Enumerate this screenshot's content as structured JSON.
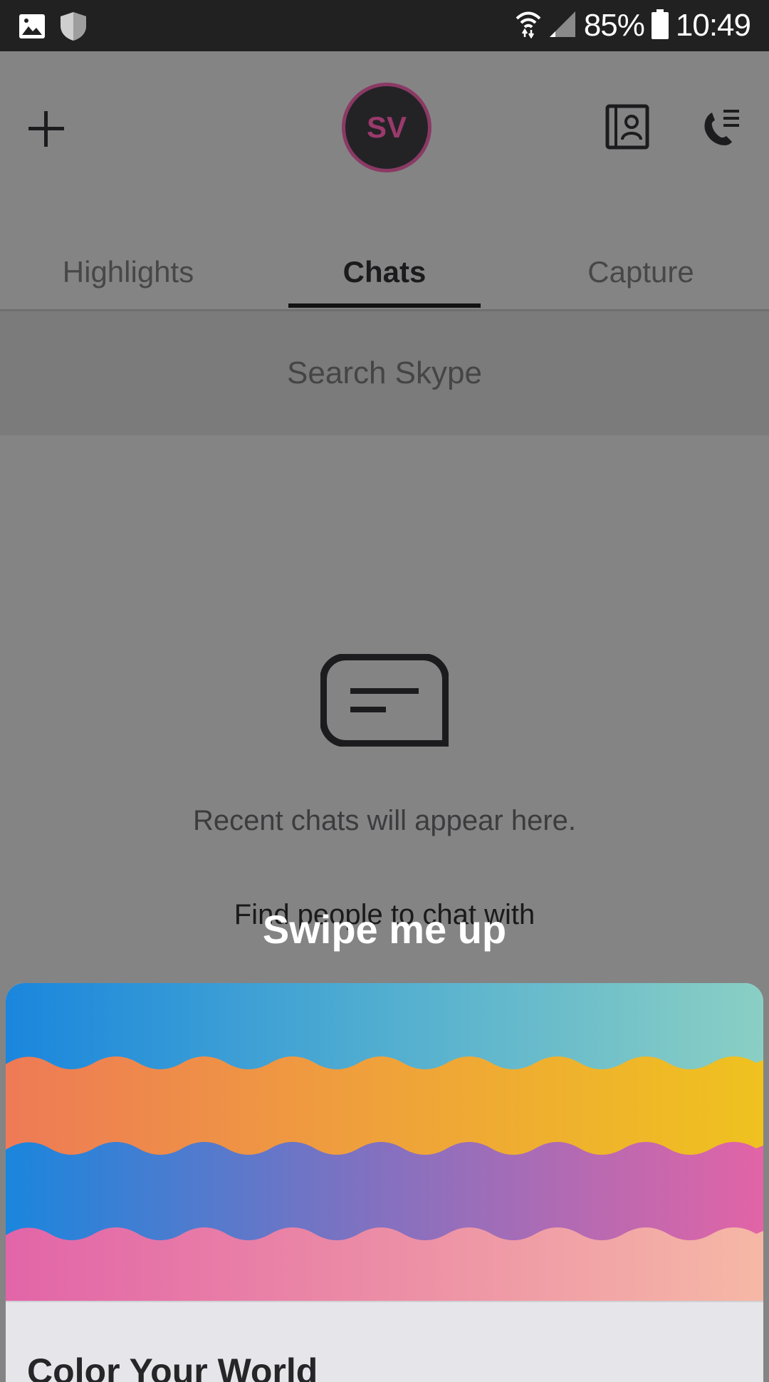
{
  "status_bar": {
    "battery": "85%",
    "time": "10:49"
  },
  "header": {
    "avatar_initials": "SV"
  },
  "tabs": [
    {
      "label": "Highlights",
      "active": false
    },
    {
      "label": "Chats",
      "active": true
    },
    {
      "label": "Capture",
      "active": false
    }
  ],
  "search": {
    "placeholder": "Search Skype"
  },
  "empty_state": {
    "message": "Recent chats will appear here.",
    "link": "Find people to chat with"
  },
  "overlay": {
    "hint": "Swipe me up"
  },
  "card": {
    "title": "Color Your World"
  },
  "colors": {
    "avatar_ring": "#8a3a64",
    "avatar_text": "#9a3a6c",
    "status_bar": "#212121"
  }
}
